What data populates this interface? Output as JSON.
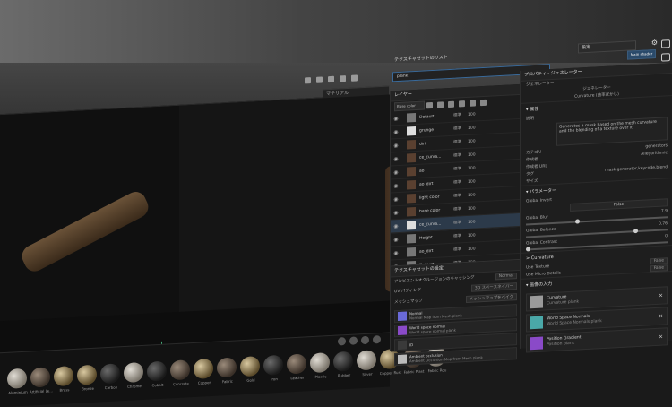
{
  "topbar": {
    "mode_select": "設定",
    "shader_button": "Main shader",
    "texture_set_list_title": "テクスチャセットのリスト",
    "search_value": "plank"
  },
  "viewport": {
    "material_select": "マテリアル"
  },
  "layers_panel": {
    "title": "レイヤー",
    "channel_select": "Base color",
    "layers": [
      {
        "name": "Default",
        "blend": "標準",
        "opacity": "100",
        "thumb": "g"
      },
      {
        "name": "grunge",
        "blend": "標準",
        "opacity": "100",
        "thumb": "w"
      },
      {
        "name": "dirt",
        "blend": "標準",
        "opacity": "100",
        "thumb": "b"
      },
      {
        "name": "ce_curva...",
        "blend": "標準",
        "opacity": "100",
        "thumb": "b"
      },
      {
        "name": "ao",
        "blend": "標準",
        "opacity": "100",
        "thumb": "b"
      },
      {
        "name": "ao_dirt",
        "blend": "標準",
        "opacity": "100",
        "thumb": "b"
      },
      {
        "name": "light color",
        "blend": "標準",
        "opacity": "100",
        "thumb": "b"
      },
      {
        "name": "base color",
        "blend": "標準",
        "opacity": "100",
        "thumb": "b"
      },
      {
        "name": "ce_curva...",
        "blend": "標準",
        "opacity": "100",
        "thumb": "w",
        "selected": true
      },
      {
        "name": "Height",
        "blend": "標準",
        "opacity": "100",
        "thumb": "g"
      },
      {
        "name": "ao_dirt",
        "blend": "標準",
        "opacity": "100",
        "thumb": "g"
      },
      {
        "name": "Default",
        "blend": "標準",
        "opacity": "100",
        "thumb": "g"
      }
    ]
  },
  "texture_set_settings": {
    "title": "テクスチャセットの設定",
    "ambient_occlusion_label": "アンビエントオクルージョンのキャッシング",
    "ambient_occlusion_value": "Normal",
    "uv_padding_label": "UV パディング",
    "uv_padding_value": "3D スペースネイバー",
    "mesh_maps_title": "メッシュマップ",
    "bake_button": "メッシュマップをベイク",
    "add_button": "+1 マップを追加",
    "bakes": [
      {
        "title": "Normal",
        "sub": "Normal Map from Mesh plank",
        "color": "#6a6ad8"
      },
      {
        "title": "World space normal",
        "sub": "World space normal plank",
        "color": "#8a4ac8"
      },
      {
        "title": "ID",
        "sub": "",
        "color": "#3a3a3a"
      },
      {
        "title": "Ambient occlusion",
        "sub": "Ambient Occlusion Map from Mesh plank",
        "color": "#bbbbbb"
      }
    ]
  },
  "properties": {
    "title": "プロパティ - ジェネレーター",
    "generator_label": "ジェネレーター",
    "generator_name": "ジェネレーター",
    "generator_sub": "Curvature (曲率ぼかし)",
    "section_basic": "▾ 属性",
    "desc_label": "説明",
    "description": "Generates a mask based on the mesh curvature and the blending of a texture over it.",
    "category_label": "カテゴリ",
    "category_value": "generators",
    "author_label": "作成者",
    "author_value": "Allegorithmic",
    "author_url_label": "作成者 URL",
    "tag_label": "タグ",
    "tag_value": "mask,generator,keycode,blend",
    "size_label": "サイズ",
    "section_params": "▾ パラメーター",
    "global_invert_label": "Global Invert",
    "global_invert_value": "False",
    "global_blur_label": "Global Blur",
    "global_blur_value": "7.9",
    "global_balance_label": "Global Balance",
    "global_balance_value": "0.76",
    "global_contrast_label": "Global Contrast",
    "global_contrast_value": "0",
    "section_curvature": "> Curvature",
    "use_texture_label": "Use Texture",
    "use_texture_value": "False",
    "use_micro_details_label": "Use Micro Details",
    "use_micro_details_value": "False",
    "section_inputs": "▾ 画像の入力",
    "inputs": [
      {
        "title": "Curvature",
        "sub": "Curvature plank",
        "color": "#9a9a9a"
      },
      {
        "title": "World Space Normals",
        "sub": "World Space Normals plank",
        "color": "#4aa8a8"
      },
      {
        "title": "Position Gradient",
        "sub": "Position plank",
        "color": "#8a4ac8"
      }
    ]
  },
  "shelf": {
    "materials": [
      {
        "label": "Aluminium",
        "style": "light"
      },
      {
        "label": "Artificial Le...",
        "style": ""
      },
      {
        "label": "Brass",
        "style": "metal"
      },
      {
        "label": "Bronze",
        "style": "metal"
      },
      {
        "label": "Carbon",
        "style": "dark"
      },
      {
        "label": "Chrome",
        "style": "light"
      },
      {
        "label": "Cobalt",
        "style": "dark"
      },
      {
        "label": "Concrete",
        "style": ""
      },
      {
        "label": "Copper",
        "style": "metal"
      },
      {
        "label": "Fabric",
        "style": ""
      },
      {
        "label": "Gold",
        "style": "metal"
      },
      {
        "label": "Iron",
        "style": "dark"
      },
      {
        "label": "Leather",
        "style": ""
      },
      {
        "label": "Plastic",
        "style": "light"
      },
      {
        "label": "Rubber",
        "style": "dark"
      },
      {
        "label": "Silver",
        "style": "light"
      },
      {
        "label": "Copper Rust",
        "style": "metal"
      },
      {
        "label": "Fabric Plast",
        "style": ""
      },
      {
        "label": "Fabric Rou",
        "style": "light"
      }
    ]
  }
}
